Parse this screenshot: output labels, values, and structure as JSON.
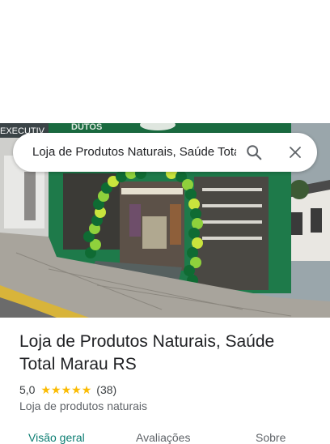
{
  "search": {
    "query": "Loja de Produtos Naturais, Saúde Total Marau RS",
    "search_icon": "search-icon",
    "close_icon": "close-icon"
  },
  "photo": {
    "sign_text": "EXECUTIV",
    "sign_text_2": "DUTOS"
  },
  "place": {
    "name": "Loja de Produtos Naturais, Saúde Total Marau RS",
    "rating": "5,0",
    "stars": 5,
    "review_count": "(38)",
    "category": "Loja de produtos naturais"
  },
  "tabs": [
    {
      "label": "Visão geral",
      "active": true
    },
    {
      "label": "Avaliações",
      "active": false
    },
    {
      "label": "Sobre",
      "active": false
    }
  ],
  "colors": {
    "star": "#fbbc04",
    "active_tab": "#0b7d72",
    "storefront_green": "#1e7a4a"
  }
}
